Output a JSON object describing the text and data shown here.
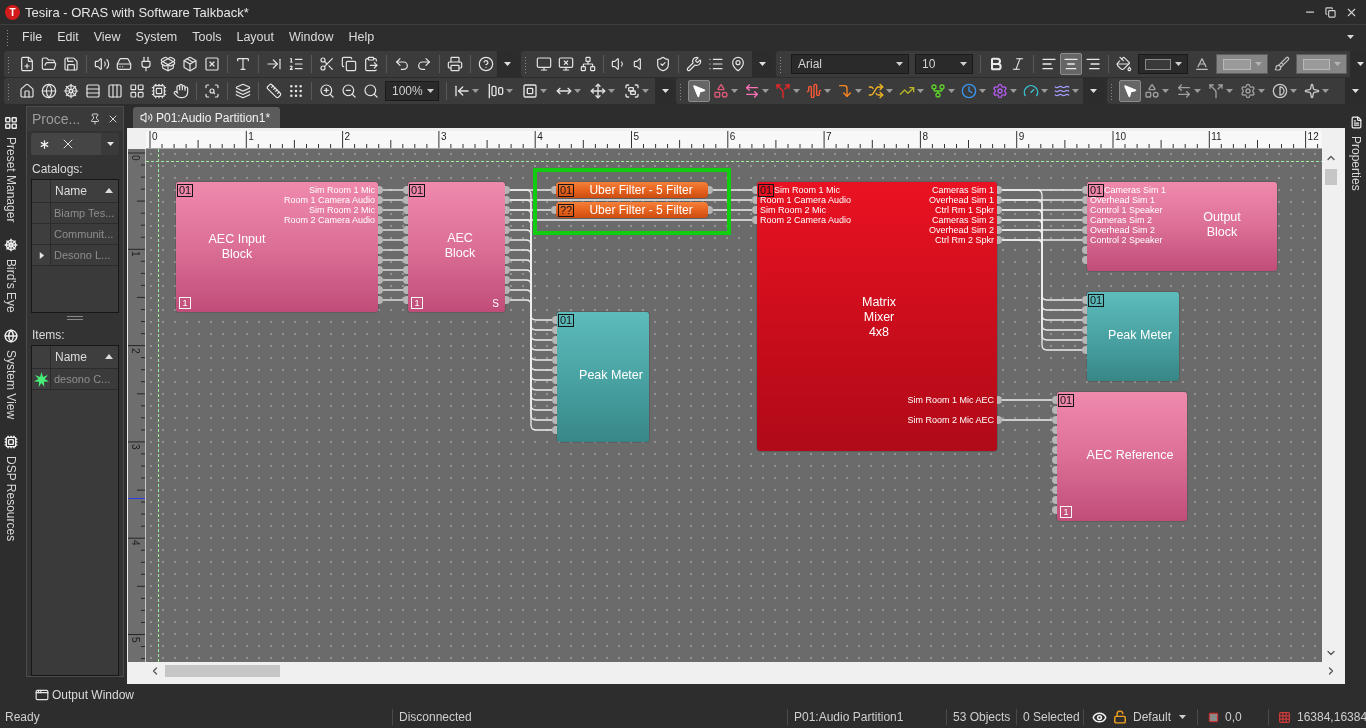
{
  "window": {
    "logo": "T",
    "title": "Tesira - ORAS with Software Talkback*"
  },
  "menu": [
    "File",
    "Edit",
    "View",
    "System",
    "Tools",
    "Layout",
    "Window",
    "Help"
  ],
  "toolbar": {
    "zoom": "100%",
    "font": "Arial",
    "font_size": "10",
    "bold": false,
    "italic": false,
    "alignment": [
      {
        "kind": "left",
        "selected": false
      },
      {
        "kind": "center",
        "selected": true
      },
      {
        "kind": "right",
        "selected": false
      }
    ],
    "color_pickers": [
      {
        "kind": "fill",
        "disabled": false
      },
      {
        "kind": "text",
        "disabled": true
      },
      {
        "kind": "line",
        "disabled": true
      }
    ],
    "palettes": [
      {
        "pointer_selected": true
      },
      {
        "pointer_selected": true
      }
    ]
  },
  "side_tabs": [
    "Preset Manager",
    "Bird's Eye",
    "System View",
    "DSP Resources"
  ],
  "processing_panel": {
    "title": "Proce...",
    "catalogs_label": "Catalogs:",
    "catalogs": {
      "column": "Name",
      "rows": [
        {
          "name": "Biamp Tes...",
          "current": false
        },
        {
          "name": "Communit...",
          "current": false
        },
        {
          "name": "Desono L...",
          "current": true
        }
      ]
    },
    "items_label": "Items:",
    "items": {
      "column": "Name",
      "rows": [
        {
          "name": "desono C..."
        }
      ]
    }
  },
  "document_tab": "P01:Audio Partition1*",
  "rulers": {
    "horizontal": [
      "0",
      "1",
      "2",
      "3",
      "4",
      "5",
      "6",
      "7",
      "8",
      "9",
      "10",
      "11",
      "12"
    ],
    "vertical": [
      "0",
      "1",
      "2",
      "3",
      "4",
      "5"
    ]
  },
  "blocks": [
    {
      "kind": "input",
      "title": "AEC Input Block",
      "badge": "01",
      "footer_badge": "1",
      "outputs": [
        "Sim Room 1 Mic",
        "Room 1 Camera Audio",
        "Sim Room 2 Mic",
        "Room 2 Camera Audio"
      ]
    },
    {
      "kind": "aec",
      "title": "AEC Block",
      "badge": "01",
      "footer_badge": "1",
      "corner_label": "S"
    },
    {
      "kind": "group",
      "outlined": true,
      "members": [
        {
          "kind": "filter",
          "title": "Uber Filter - 5 Filter",
          "badge": "01"
        },
        {
          "kind": "filter",
          "title": "Uber Filter - 5 Filter",
          "badge": "??"
        }
      ]
    },
    {
      "kind": "meter",
      "title": "Peak Meter",
      "badge": "01"
    },
    {
      "kind": "mixer",
      "title": "Matrix Mixer 4x8",
      "badge": "01",
      "inputs": [
        "Sim Room 1 Mic",
        "Room 1 Camera Audio",
        "Sim Room 2 Mic",
        "Room 2 Camera Audio"
      ],
      "outputs": [
        "Cameras Sim 1",
        "Overhead Sim 1",
        "Ctrl Rm 1 Spkr",
        "Cameras Sim 2",
        "Overhead Sim 2",
        "Ctrl Rm 2 Spkr",
        "Sim Room 1 Mic AEC",
        "Sim Room 2 Mic AEC"
      ]
    },
    {
      "kind": "output",
      "title": "Output Block",
      "badge": "01",
      "inputs": [
        "Cameras Sim 1",
        "Overhead Sim 1",
        "Control 1 Speaker",
        "Cameras Sim 2",
        "Overhead Sim 2",
        "Control 2 Speaker"
      ]
    },
    {
      "kind": "meter",
      "title": "Peak Meter",
      "badge": "01"
    },
    {
      "kind": "reference",
      "title": "AEC Reference",
      "badge": "01",
      "footer_badge": "1"
    }
  ],
  "right_tabs": [
    "Properties"
  ],
  "output_tab": "Output Window",
  "status_bar": {
    "state": "Ready",
    "connection": "Disconnected",
    "partition": "P01:Audio Partition1",
    "objects": "53 Objects",
    "selection": "0 Selected",
    "preset": "Default",
    "origin": "0,0",
    "extent": "16384,16384"
  }
}
